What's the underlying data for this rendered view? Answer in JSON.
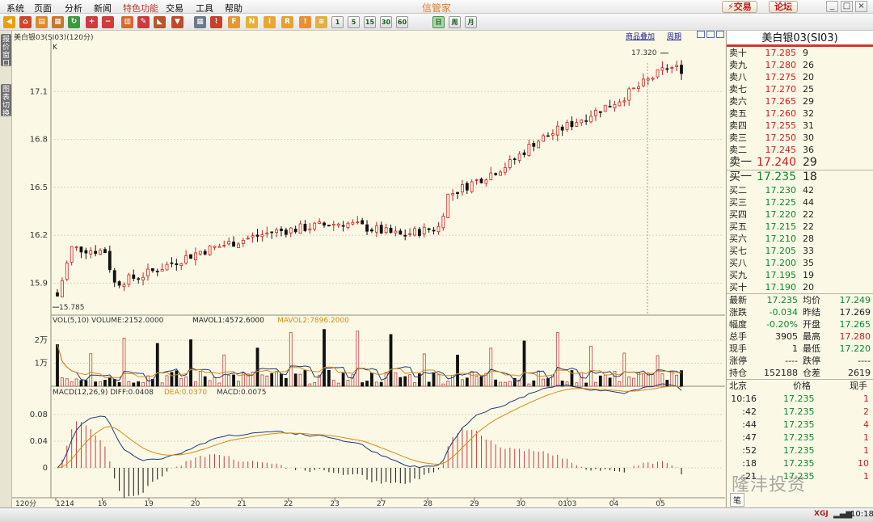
{
  "app_title": "信管家",
  "menu": [
    "系统",
    "页面",
    "分析",
    "新闻",
    "特色功能",
    "交易",
    "工具",
    "帮助"
  ],
  "top_buttons": {
    "trade": "⚡交易",
    "forum": "论坛"
  },
  "window_controls": [
    "_",
    "□",
    "×"
  ],
  "toolbar_periods": [
    "1",
    "5",
    "15",
    "30",
    "60",
    "日",
    "周",
    "月"
  ],
  "toolbar_selected_period": "日",
  "left_tabs": [
    "报价窗口",
    "图表切换"
  ],
  "chart": {
    "symbol_header": "美白银03(SI03)(120分)",
    "k_label": "K",
    "header_links": [
      "商品叠加",
      "周期"
    ],
    "high_label": "17.320",
    "low_label": "15.785",
    "y_ticks": [
      "17.1",
      "16.8",
      "16.5",
      "16.2",
      "15.9"
    ],
    "vol_header": "VOL(5,10) VOLUME:2152.0000",
    "vol_mavol1": "MAVOL1:4572.6000",
    "vol_mavol2": "MAVOL2:7896.2000",
    "vol_ticks": [
      "2万",
      "1万"
    ],
    "macd_header": "MACD(12,26,9) DIFF:0.0408",
    "macd_dea": "DEA:0.0370",
    "macd_val": "MACD:0.0075",
    "macd_ticks": [
      "0.08",
      "0.04",
      "0"
    ],
    "period_label": "120分",
    "x_labels": [
      "1214",
      "16",
      "19",
      "20",
      "21",
      "22",
      "23",
      "27",
      "28",
      "29",
      "30",
      "0103",
      "04",
      "05"
    ]
  },
  "chart_data": {
    "type": "candlestick",
    "price_range": [
      15.785,
      17.32
    ],
    "volume_unit": "万",
    "macd_params": "12,26,9"
  },
  "quote": {
    "title": "美白银03(SI03)",
    "asks": [
      {
        "label": "卖十",
        "price": "17.285",
        "vol": "9"
      },
      {
        "label": "卖九",
        "price": "17.280",
        "vol": "26"
      },
      {
        "label": "卖八",
        "price": "17.275",
        "vol": "20"
      },
      {
        "label": "卖七",
        "price": "17.270",
        "vol": "25"
      },
      {
        "label": "卖六",
        "price": "17.265",
        "vol": "29"
      },
      {
        "label": "卖五",
        "price": "17.260",
        "vol": "32"
      },
      {
        "label": "卖四",
        "price": "17.255",
        "vol": "31"
      },
      {
        "label": "卖三",
        "price": "17.250",
        "vol": "30"
      },
      {
        "label": "卖二",
        "price": "17.245",
        "vol": "36"
      },
      {
        "label": "卖一",
        "price": "17.240",
        "vol": "29"
      }
    ],
    "bids": [
      {
        "label": "买一",
        "price": "17.235",
        "vol": "18"
      },
      {
        "label": "买二",
        "price": "17.230",
        "vol": "42"
      },
      {
        "label": "买三",
        "price": "17.225",
        "vol": "44"
      },
      {
        "label": "买四",
        "price": "17.220",
        "vol": "22"
      },
      {
        "label": "买五",
        "price": "17.215",
        "vol": "22"
      },
      {
        "label": "买六",
        "price": "17.210",
        "vol": "28"
      },
      {
        "label": "买七",
        "price": "17.205",
        "vol": "33"
      },
      {
        "label": "买八",
        "price": "17.200",
        "vol": "35"
      },
      {
        "label": "买九",
        "price": "17.195",
        "vol": "19"
      },
      {
        "label": "买十",
        "price": "17.190",
        "vol": "20"
      }
    ],
    "stats": [
      {
        "l1": "最新",
        "v1": "17.235",
        "c1": "green",
        "l2": "均价",
        "v2": "17.249",
        "c2": "green"
      },
      {
        "l1": "涨跌",
        "v1": "-0.034",
        "c1": "green",
        "l2": "昨结",
        "v2": "17.269",
        "c2": "dark"
      },
      {
        "l1": "幅度",
        "v1": "-0.20%",
        "c1": "green",
        "l2": "开盘",
        "v2": "17.265",
        "c2": "green"
      },
      {
        "l1": "总手",
        "v1": "3905",
        "c1": "dark",
        "l2": "最高",
        "v2": "17.280",
        "c2": "red"
      },
      {
        "l1": "现手",
        "v1": "1",
        "c1": "dark",
        "l2": "最低",
        "v2": "17.220",
        "c2": "green"
      },
      {
        "l1": "涨停",
        "v1": "----",
        "c1": "dark",
        "l2": "跌停",
        "v2": "----",
        "c2": "dark"
      },
      {
        "l1": "持仓",
        "v1": "152188",
        "c1": "dark",
        "l2": "仓差",
        "v2": "2619",
        "c2": "dark"
      }
    ],
    "ticks_header": {
      "c1": "北京",
      "c2": "价格",
      "c3": "现手"
    },
    "ticks": [
      {
        "t": "10:16",
        "p": "17.235",
        "v": "1"
      },
      {
        "t": ":42",
        "p": "17.235",
        "v": "2"
      },
      {
        "t": ":44",
        "p": "17.235",
        "v": "4"
      },
      {
        "t": ":47",
        "p": "17.235",
        "v": "1"
      },
      {
        "t": ":52",
        "p": "17.235",
        "v": "1"
      },
      {
        "t": ":18",
        "p": "17.235",
        "v": "10"
      },
      {
        "t": ":21",
        "p": "17.235",
        "v": "1"
      }
    ],
    "side_footer": "笔"
  },
  "watermark": "隆沣投资",
  "status": {
    "left": "XGJ",
    "time": "10:18"
  }
}
